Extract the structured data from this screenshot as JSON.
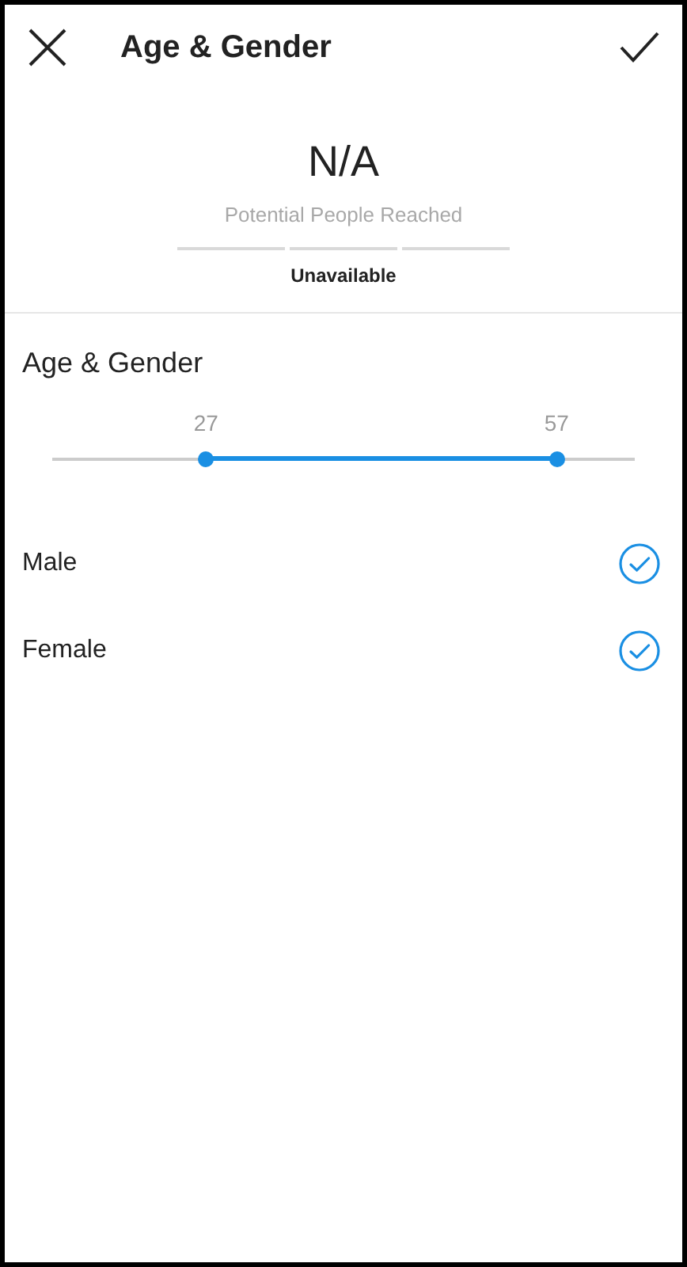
{
  "header": {
    "title": "Age & Gender"
  },
  "audience": {
    "value": "N/A",
    "label": "Potential People Reached",
    "status": "Unavailable"
  },
  "section": {
    "title": "Age & Gender"
  },
  "age_range": {
    "thumbs": [
      {
        "reading": "27",
        "level": 0.264
      },
      {
        "reading": "57",
        "level": 0.866
      }
    ]
  },
  "genders": [
    {
      "label": "Male",
      "checked": true
    },
    {
      "label": "Female",
      "checked": true
    }
  ]
}
